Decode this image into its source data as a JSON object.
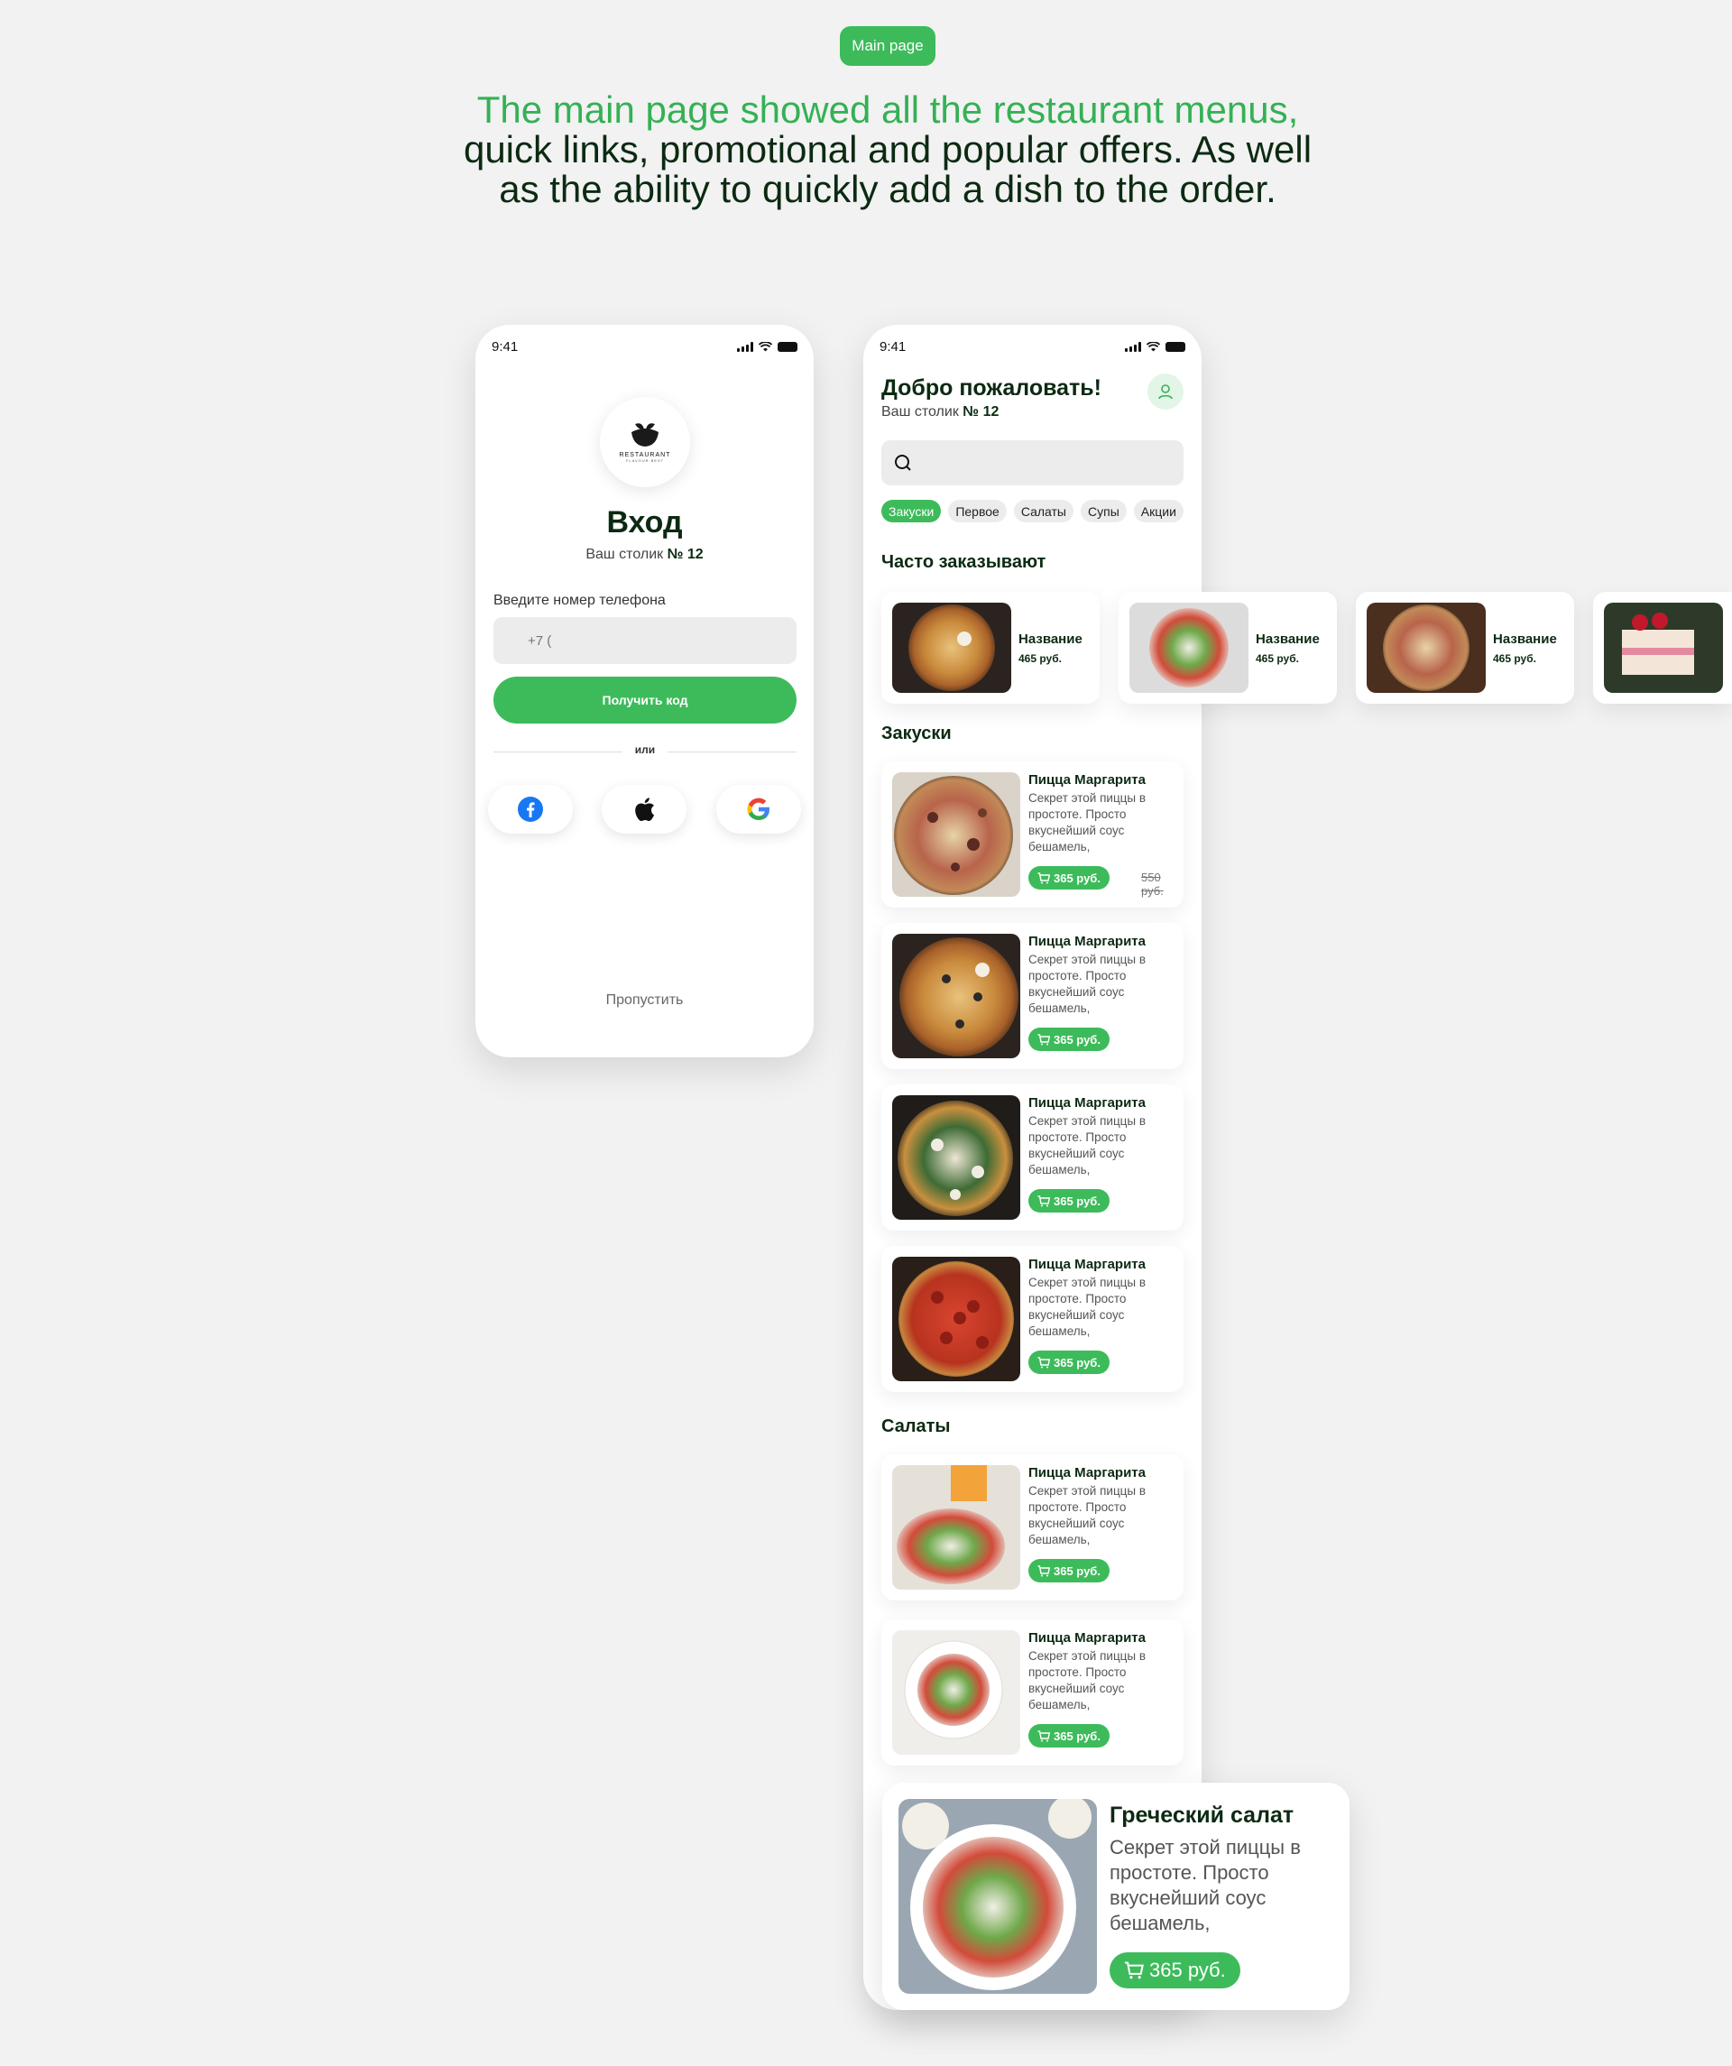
{
  "label": "Main page",
  "headline": {
    "line1": "The main page showed all the restaurant menus,",
    "line2": "quick links, promotional and popular offers. As well",
    "line3": "as the ability to quickly add a dish to the order."
  },
  "colors": {
    "accent": "#3dbb5b",
    "text": "#0c2a12",
    "background": "#f2f2f2"
  },
  "login": {
    "time": "9:41",
    "logo_text": "RESTAURANT",
    "logo_sub": "FLAVOUR BEST",
    "title": "Вход",
    "table_prefix": "Ваш столик",
    "table_number": "№ 12",
    "phone_label": "Введите номер телефона",
    "phone_placeholder": "+7 (",
    "get_code": "Получить код",
    "or": "или",
    "skip": "Пропустить",
    "social": [
      "facebook-icon",
      "apple-icon",
      "google-icon"
    ]
  },
  "main": {
    "time": "9:41",
    "greeting": "Добро пожаловать!",
    "table_prefix": "Ваш столик",
    "table_number": "№ 12",
    "search_placeholder": "",
    "chips": [
      "Закуски",
      "Первое",
      "Салаты",
      "Супы",
      "Акции"
    ],
    "popular_title": "Часто заказывают",
    "popular": [
      {
        "name": "Название",
        "price": "465 руб."
      },
      {
        "name": "Название",
        "price": "465 руб."
      },
      {
        "name": "Название",
        "price": "465 руб."
      },
      {
        "name": "",
        "price": ""
      }
    ],
    "section_snacks": "Закуски",
    "section_salads": "Салаты",
    "dishes": [
      {
        "name": "Пицца Маргарита",
        "desc": "Секрет этой пиццы в простоте. Просто вкуснейший соус бешамель,",
        "price": "365 руб.",
        "old_price": "550 руб."
      },
      {
        "name": "Пицца Маргарита",
        "desc": "Секрет этой пиццы в простоте. Просто вкуснейший соус бешамель,",
        "price": "365 руб."
      },
      {
        "name": "Пицца Маргарита",
        "desc": "Секрет этой пиццы в простоте. Просто вкуснейший соус бешамель,",
        "price": "365 руб."
      },
      {
        "name": "Пицца Маргарита",
        "desc": "Секрет этой пиццы в простоте. Просто вкуснейший соус бешамель,",
        "price": "365 руб."
      },
      {
        "name": "Пицца Маргарита",
        "desc": "Секрет этой пиццы в простоте. Просто вкуснейший соус бешамель,",
        "price": "365 руб."
      },
      {
        "name": "Пицца Маргарита",
        "desc": "Секрет этой пиццы в простоте. Просто вкуснейший соус бешамель,",
        "price": "365 руб."
      }
    ],
    "featured": {
      "name": "Греческий салат",
      "desc": "Секрет этой пиццы в простоте. Просто вкуснейший соус бешамель,",
      "price": "365 руб."
    }
  }
}
